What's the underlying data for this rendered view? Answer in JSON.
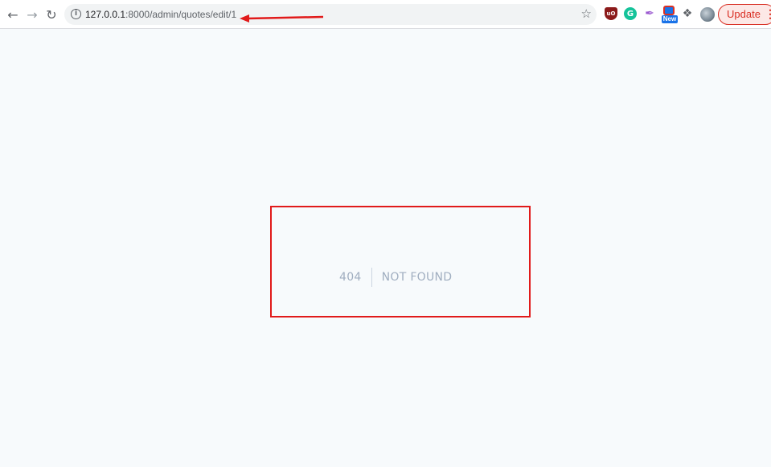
{
  "browser": {
    "url_host": "127.0.0.1",
    "url_path": ":8000/admin/quotes/edit/1",
    "update_label": "Update",
    "extensions": {
      "ublock_label": "uO",
      "grammarly_label": "G",
      "new_badge": "New"
    }
  },
  "page": {
    "error_code": "404",
    "error_message": "NOT FOUND"
  },
  "colors": {
    "annotation": "#e11a1a",
    "page_bg": "#f7fafc",
    "error_text": "#a0aec0"
  }
}
